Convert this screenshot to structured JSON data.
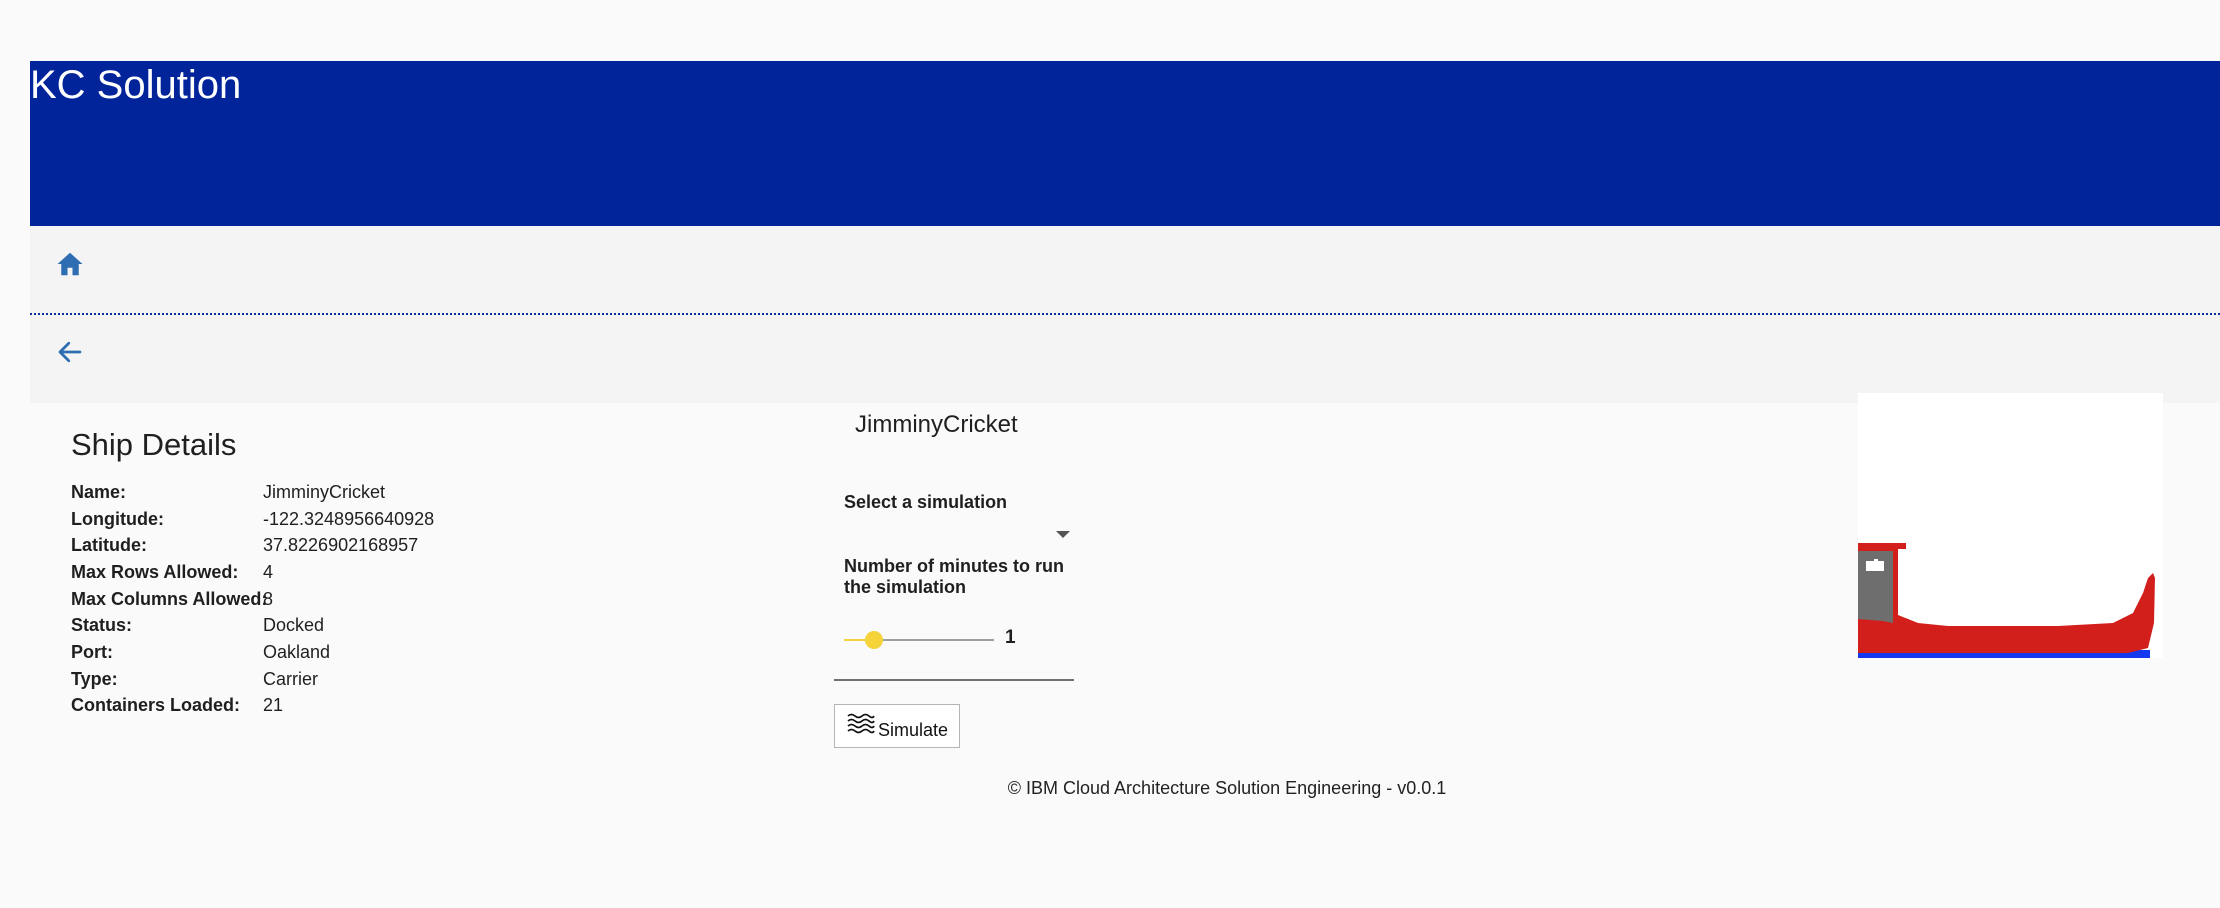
{
  "app": {
    "title": "KC Solution"
  },
  "nav": {
    "home_icon": "home-icon",
    "back_icon": "arrow-left-icon"
  },
  "ship_details": {
    "title": "Ship Details",
    "rows": [
      {
        "label": "Name:",
        "value": "JimminyCricket"
      },
      {
        "label": "Longitude:",
        "value": "-122.3248956640928"
      },
      {
        "label": "Latitude:",
        "value": "37.8226902168957"
      },
      {
        "label": "Max Rows Allowed:",
        "value": "4"
      },
      {
        "label": "Max Columns Allowed:",
        "value": "8"
      },
      {
        "label": "Status:",
        "value": "Docked"
      },
      {
        "label": "Port:",
        "value": "Oakland"
      },
      {
        "label": "Type:",
        "value": "Carrier"
      },
      {
        "label": "Containers Loaded:",
        "value": "21"
      }
    ]
  },
  "simulation": {
    "ship_name": "JimminyCricket",
    "select_label": "Select a simulation",
    "selected_value": "",
    "minutes_label": "Number of minutes to run the simulation",
    "minutes_value": "1",
    "slider_fraction": 0.2,
    "button_label": "Simulate",
    "button_icon": "waves-icon"
  },
  "colors": {
    "header_bg": "#01249b",
    "accent": "#2f6db3",
    "slider": "#f5d33a",
    "ship_hull": "#d31f1b",
    "ship_cabin": "#6e6e6e",
    "water": "#1438f0"
  },
  "footer": {
    "text": "© IBM Cloud Architecture Solution Engineering - v0.0.1"
  }
}
